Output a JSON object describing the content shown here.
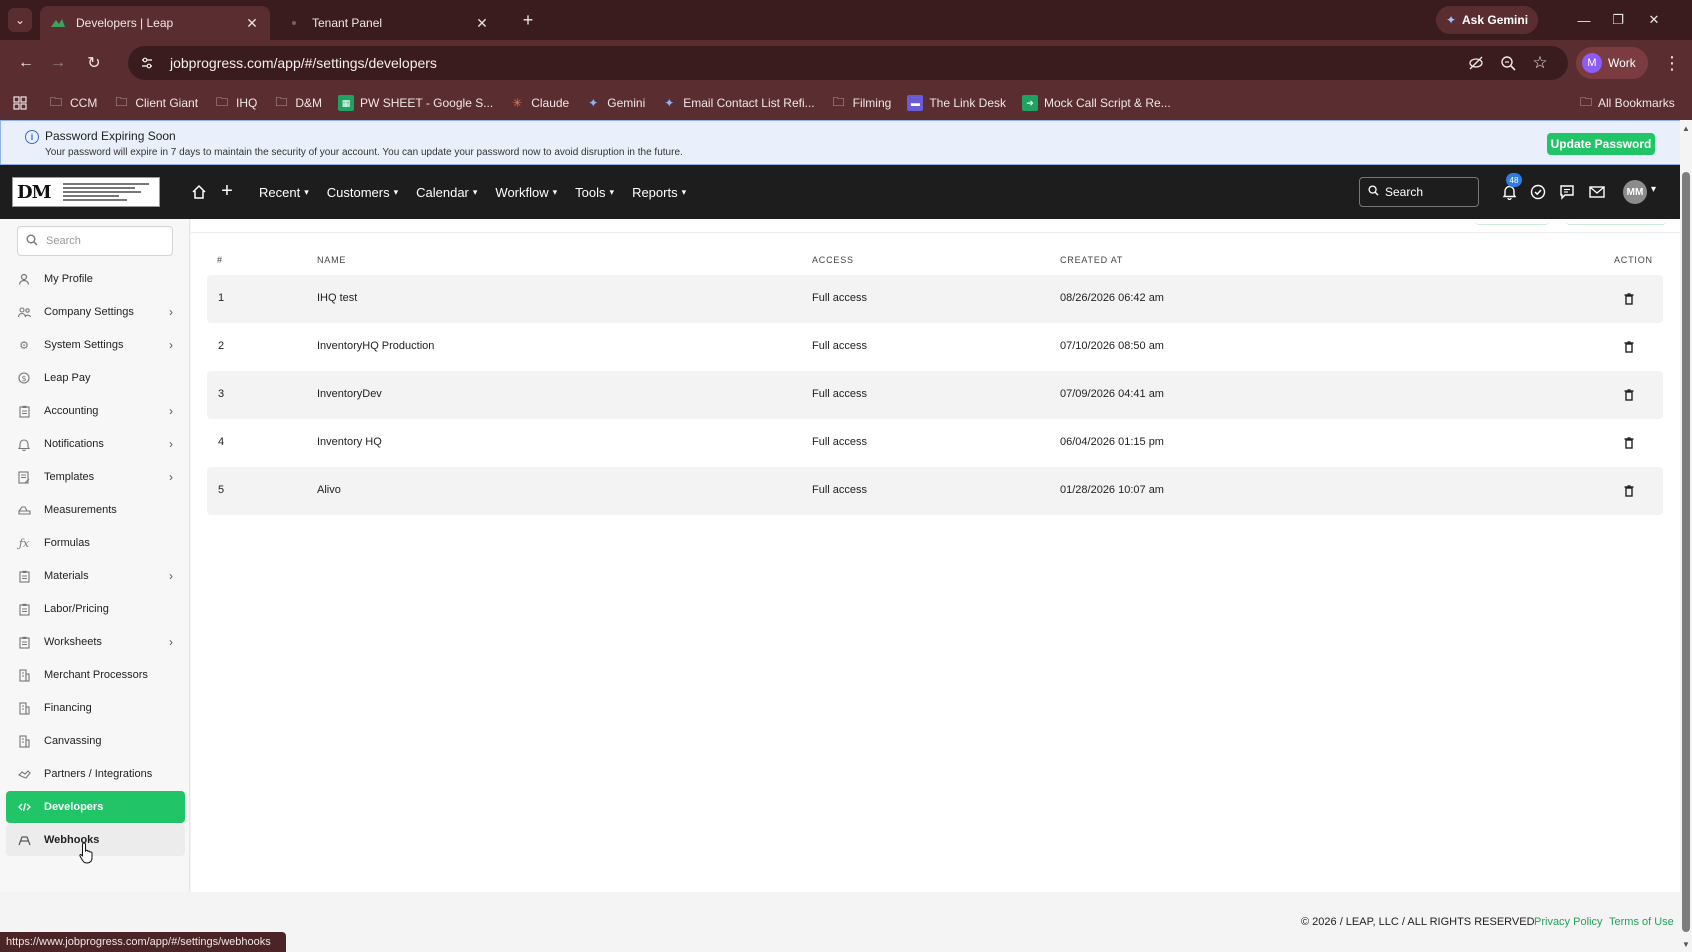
{
  "browser": {
    "tabs": [
      {
        "title": "Developers | Leap",
        "active": true
      },
      {
        "title": "Tenant Panel",
        "active": false
      }
    ],
    "url": "jobprogress.com/app/#/settings/developers",
    "ask_gemini": "Ask Gemini",
    "profile_initial": "M",
    "profile_label": "Work",
    "bookmarks": [
      "CCM",
      "Client Giant",
      "IHQ",
      "D&M",
      "PW SHEET - Google S...",
      "Claude",
      "Gemini",
      "Email Contact List Refi...",
      "Filming",
      "The Link Desk",
      "Mock Call Script & Re..."
    ],
    "all_bookmarks": "All Bookmarks",
    "status_url": "https://www.jobprogress.com/app/#/settings/webhooks"
  },
  "banner": {
    "title": "Password Expiring Soon",
    "message": "Your password will expire in 7 days to maintain the security of your account. You can update your password now to avoid disruption in the future.",
    "button": "Update Password"
  },
  "header": {
    "logo_text": "DM",
    "nav": [
      "Recent",
      "Customers",
      "Calendar",
      "Workflow",
      "Tools",
      "Reports"
    ],
    "search_placeholder": "Search",
    "notification_count": "48",
    "avatar_initials": "MM"
  },
  "sidebar": {
    "search_placeholder": "Search",
    "items": [
      {
        "label": "My Profile",
        "icon": "user-icon",
        "has_submenu": false
      },
      {
        "label": "Company Settings",
        "icon": "company-icon",
        "has_submenu": true
      },
      {
        "label": "System Settings",
        "icon": "gear-icon",
        "has_submenu": true
      },
      {
        "label": "Leap Pay",
        "icon": "dollar-icon",
        "has_submenu": false
      },
      {
        "label": "Accounting",
        "icon": "clipboard-icon",
        "has_submenu": true
      },
      {
        "label": "Notifications",
        "icon": "bell-icon",
        "has_submenu": true
      },
      {
        "label": "Templates",
        "icon": "template-icon",
        "has_submenu": true
      },
      {
        "label": "Measurements",
        "icon": "measure-icon",
        "has_submenu": false
      },
      {
        "label": "Formulas",
        "icon": "function-icon",
        "has_submenu": false
      },
      {
        "label": "Materials",
        "icon": "clipboard-icon",
        "has_submenu": true
      },
      {
        "label": "Labor/Pricing",
        "icon": "clipboard-icon",
        "has_submenu": false
      },
      {
        "label": "Worksheets",
        "icon": "clipboard-icon",
        "has_submenu": true
      },
      {
        "label": "Merchant Processors",
        "icon": "building-icon",
        "has_submenu": false
      },
      {
        "label": "Financing",
        "icon": "building-icon",
        "has_submenu": false
      },
      {
        "label": "Canvassing",
        "icon": "building-icon",
        "has_submenu": false
      },
      {
        "label": "Partners / Integrations",
        "icon": "handshake-icon",
        "has_submenu": false
      },
      {
        "label": "Developers",
        "icon": "code-icon",
        "has_submenu": false,
        "state": "active"
      },
      {
        "label": "Webhooks",
        "icon": "webhook-icon",
        "has_submenu": false,
        "state": "hover"
      }
    ]
  },
  "table": {
    "headers": [
      "#",
      "NAME",
      "ACCESS",
      "CREATED AT",
      "ACTION"
    ],
    "rows": [
      {
        "num": "1",
        "name": "IHQ test",
        "access": "Full access",
        "created": "08/26/2026 06:42 am"
      },
      {
        "num": "2",
        "name": "InventoryHQ Production",
        "access": "Full access",
        "created": "07/10/2026 08:50 am"
      },
      {
        "num": "3",
        "name": "InventoryDev",
        "access": "Full access",
        "created": "07/09/2026 04:41 am"
      },
      {
        "num": "4",
        "name": "Inventory HQ",
        "access": "Full access",
        "created": "06/04/2026 01:15 pm"
      },
      {
        "num": "5",
        "name": "Alivo",
        "access": "Full access",
        "created": "01/28/2026 10:07 am"
      }
    ]
  },
  "footer": {
    "copyright": "© 2026 / LEAP, LLC / ALL RIGHTS RESERVED",
    "privacy": "Privacy Policy",
    "terms": "Terms of Use"
  },
  "colors": {
    "accent_green": "#21c466",
    "header_dark": "#1d1d1d",
    "browser_frame": "#5a2e31",
    "banner_bg": "#e9f0fb",
    "link_green": "#21a35a"
  }
}
